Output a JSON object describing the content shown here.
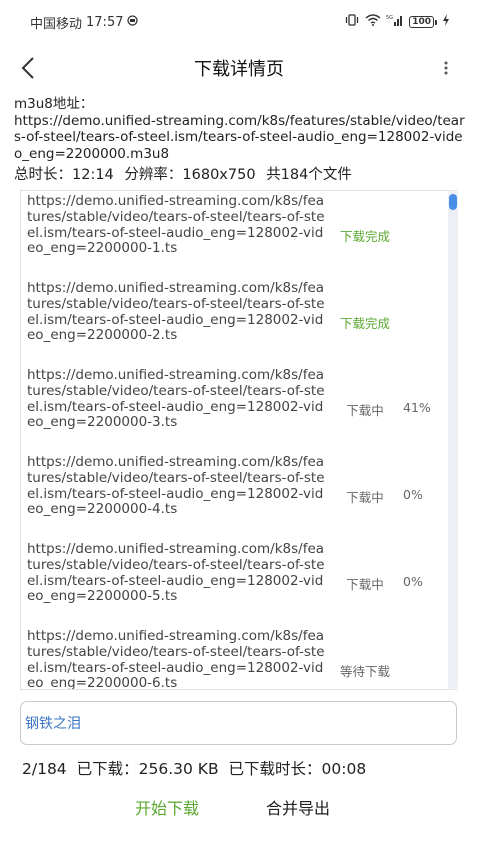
{
  "status_bar": {
    "carrier": "中国移动",
    "time": "17:57",
    "battery": "100"
  },
  "app_bar": {
    "title": "下载详情页",
    "back_icon": "back-arrow-icon",
    "more_icon": "more-vertical-icon"
  },
  "info": {
    "m3u8_label": "m3u8地址：",
    "m3u8_url": "https://demo.unified-streaming.com/k8s/features/stable/video/tears-of-steel/tears-of-steel.ism/tears-of-steel-audio_eng=128002-video_eng=2200000.m3u8",
    "duration_label": "总时长：",
    "duration": "12:14",
    "resolution_label": "分辨率：",
    "resolution": "1680x750",
    "file_count": "共184个文件"
  },
  "files": [
    {
      "url": "https://demo.unified-streaming.com/k8s/features/stable/video/tears-of-steel/tears-of-steel.ism/tears-of-steel-audio_eng=128002-video_eng=2200000-1.ts",
      "status": "下载完成",
      "progress": ""
    },
    {
      "url": "https://demo.unified-streaming.com/k8s/features/stable/video/tears-of-steel/tears-of-steel.ism/tears-of-steel-audio_eng=128002-video_eng=2200000-2.ts",
      "status": "下载完成",
      "progress": ""
    },
    {
      "url": "https://demo.unified-streaming.com/k8s/features/stable/video/tears-of-steel/tears-of-steel.ism/tears-of-steel-audio_eng=128002-video_eng=2200000-3.ts",
      "status": "下载中",
      "progress": "41%"
    },
    {
      "url": "https://demo.unified-streaming.com/k8s/features/stable/video/tears-of-steel/tears-of-steel.ism/tears-of-steel-audio_eng=128002-video_eng=2200000-4.ts",
      "status": "下载中",
      "progress": "0%"
    },
    {
      "url": "https://demo.unified-streaming.com/k8s/features/stable/video/tears-of-steel/tears-of-steel.ism/tears-of-steel-audio_eng=128002-video_eng=2200000-5.ts",
      "status": "下载中",
      "progress": "0%"
    },
    {
      "url": "https://demo.unified-streaming.com/k8s/features/stable/video/tears-of-steel/tears-of-steel.ism/tears-of-steel-audio_eng=128002-video_eng=2200000-6.ts",
      "status": "等待下载",
      "progress": ""
    }
  ],
  "name_input": {
    "value": "钢铁之泪"
  },
  "stats": {
    "count": "2/184",
    "downloaded_label": "已下载：",
    "downloaded": "256.30 KB",
    "time_label": "已下载时长：",
    "time": "00:08"
  },
  "actions": {
    "start": "开始下载",
    "merge": "合并导出"
  },
  "colors": {
    "done": "#5aa832",
    "accent": "#4a8fe7",
    "input_text": "#3a76c2"
  }
}
